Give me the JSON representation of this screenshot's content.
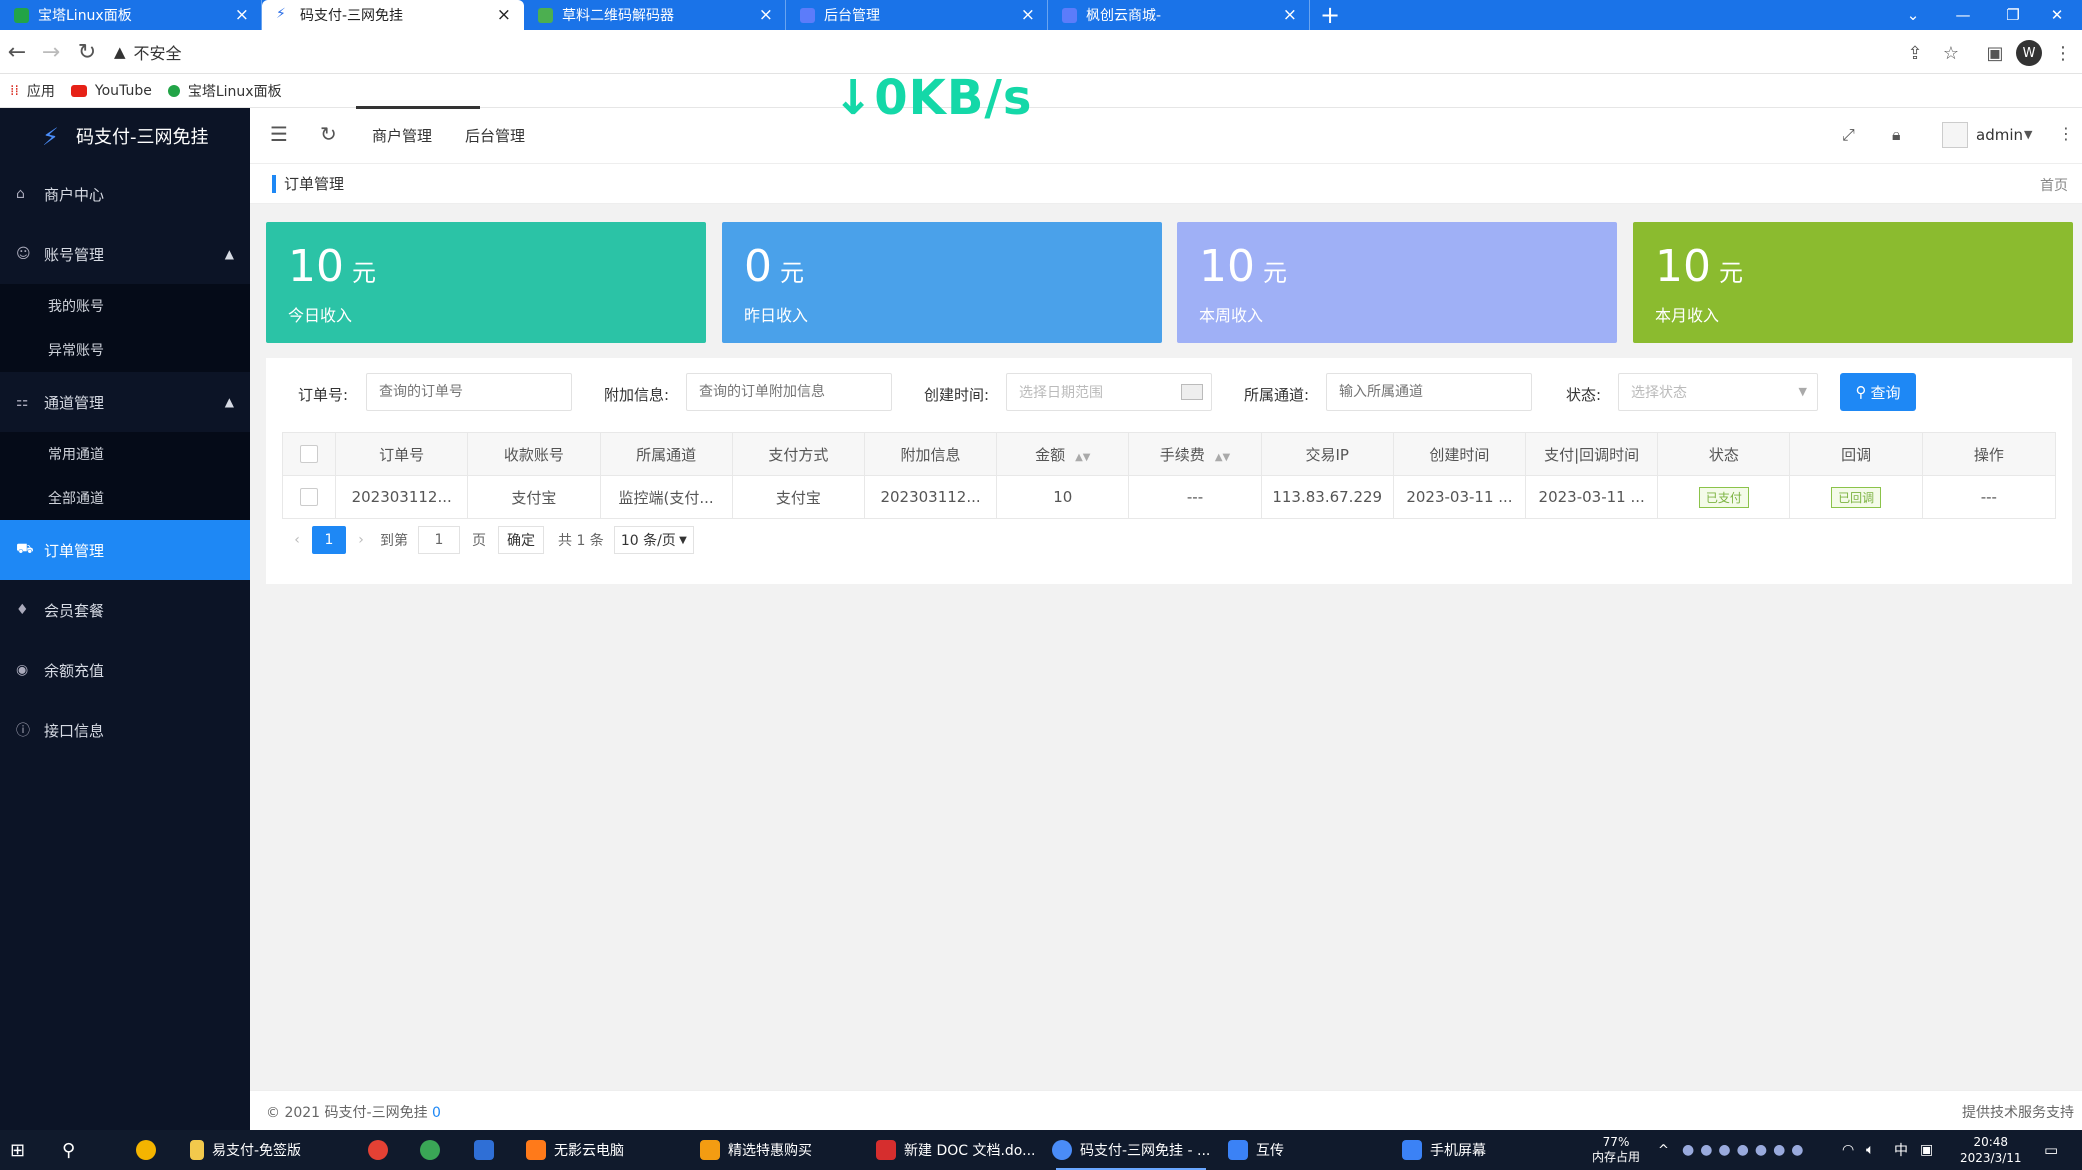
{
  "browser": {
    "tabs": [
      {
        "label": "宝塔Linux面板",
        "color": "#22a447"
      },
      {
        "label": "码支付-三网免挂",
        "color": "#2b6ee6",
        "active": true
      },
      {
        "label": "草料二维码解码器",
        "color": "#4caf50"
      },
      {
        "label": "后台管理",
        "color": "#5c7cfa"
      },
      {
        "label": "枫创云商城-",
        "color": "#5c7cfa"
      }
    ],
    "address": {
      "security": "不安全",
      "url": ""
    },
    "bookmarks": [
      "应用",
      "YouTube",
      "宝塔Linux面板"
    ],
    "profile_initial": "W"
  },
  "overlay": {
    "speed": "↓0KB/s"
  },
  "sidebar": {
    "logo": "码支付-三网免挂",
    "menu": [
      {
        "label": "商户中心"
      },
      {
        "label": "账号管理",
        "children": [
          "我的账号",
          "异常账号"
        ]
      },
      {
        "label": "通道管理",
        "children": [
          "常用通道",
          "全部通道"
        ]
      },
      {
        "label": "订单管理",
        "active": true
      },
      {
        "label": "会员套餐"
      },
      {
        "label": "余额充值"
      },
      {
        "label": "接口信息"
      }
    ]
  },
  "header": {
    "nav": [
      "商户管理",
      "后台管理"
    ],
    "user": "admin"
  },
  "breadcrumb": {
    "title": "订单管理",
    "home": "首页"
  },
  "stats": [
    {
      "value": "10",
      "unit": "元",
      "label": "今日收入",
      "color": "#2bc3a6"
    },
    {
      "value": "0",
      "unit": "元",
      "label": "昨日收入",
      "color": "#4aa1ea"
    },
    {
      "value": "10",
      "unit": "元",
      "label": "本周收入",
      "color": "#9fb0f6"
    },
    {
      "value": "10",
      "unit": "元",
      "label": "本月收入",
      "color": "#8bbb2f"
    }
  ],
  "filters": {
    "order_label": "订单号:",
    "order_placeholder": "查询的订单号",
    "extra_label": "附加信息:",
    "extra_placeholder": "查询的订单附加信息",
    "time_label": "创建时间:",
    "time_placeholder": "选择日期范围",
    "channel_label": "所属通道:",
    "channel_placeholder": "输入所属通道",
    "status_label": "状态:",
    "status_placeholder": "选择状态",
    "search_button": "查询"
  },
  "table": {
    "headers": [
      "订单号",
      "收款账号",
      "所属通道",
      "支付方式",
      "附加信息",
      "金额",
      "手续费",
      "交易IP",
      "创建时间",
      "支付|回调时间",
      "状态",
      "回调",
      "操作"
    ],
    "rows": [
      [
        "202303112...",
        "支付宝",
        "监控端(支付...",
        "支付宝",
        "202303112...",
        "10",
        "---",
        "113.83.67.229",
        "2023-03-11 ...",
        "2023-03-11 ...",
        "已支付",
        "已回调",
        "---"
      ]
    ]
  },
  "pager": {
    "current": "1",
    "goto_label": "到第",
    "goto_value": "1",
    "page_label": "页",
    "confirm": "确定",
    "total": "共 1 条",
    "page_size": "10 条/页"
  },
  "footer": {
    "copyright": "© 2021 码支付-三网免挂",
    "version": "0",
    "right": "提供技术服务支持"
  },
  "taskbar": {
    "apps": [
      "易支付-免签版",
      "无影云电脑",
      "精选特惠购买",
      "新建 DOC 文档.do...",
      "码支付-三网免挂 - ...",
      "互传",
      "手机屏幕"
    ],
    "memory": "77%",
    "memory_label": "内存占用",
    "ime": "中",
    "time": "20:48",
    "date": "2023/3/11"
  }
}
